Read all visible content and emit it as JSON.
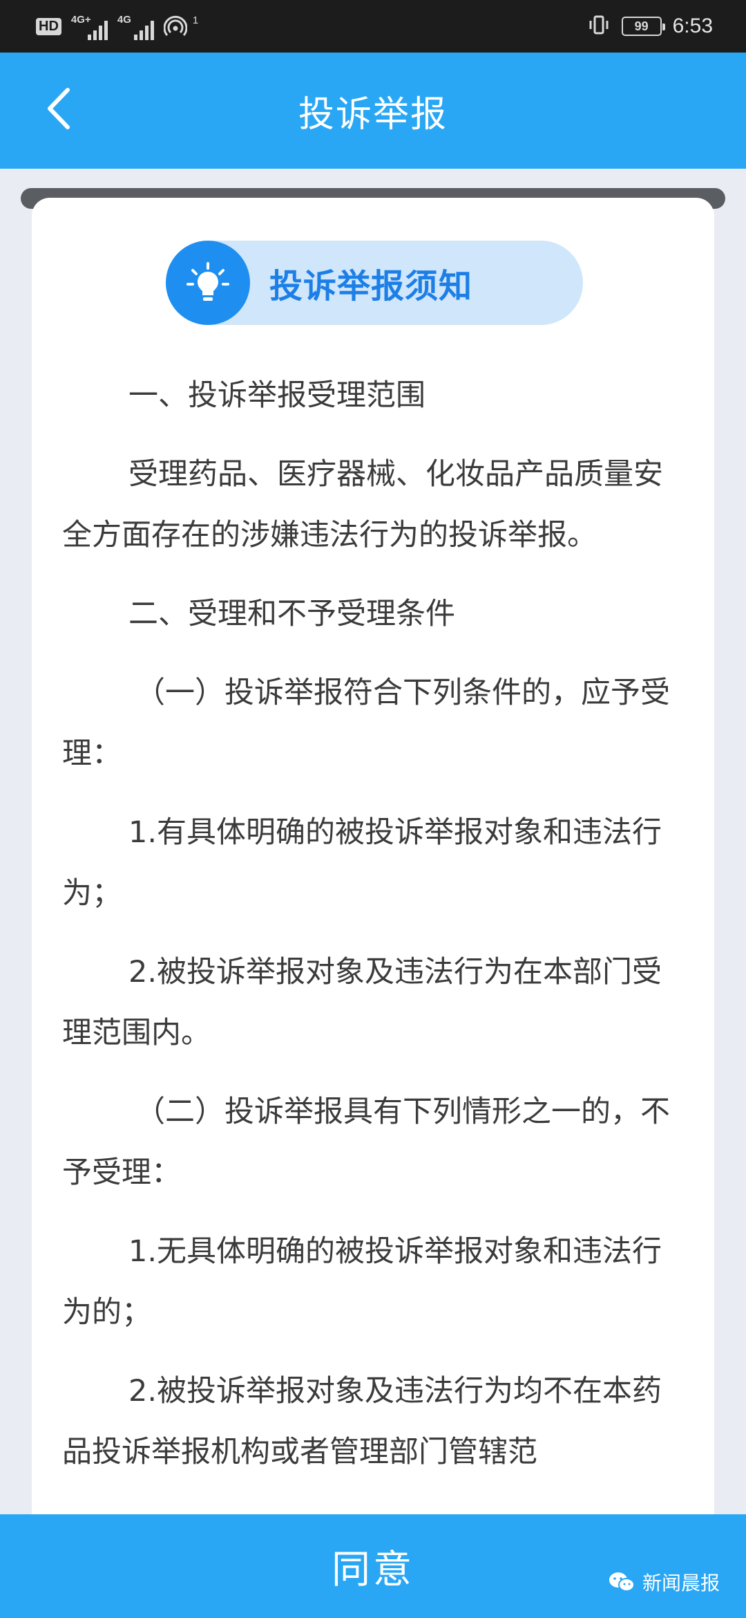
{
  "status_bar": {
    "hd": "HD",
    "network_1": "4G+",
    "network_2": "4G",
    "hotspot_count": "1",
    "battery": "99",
    "time": "6:53"
  },
  "header": {
    "title": "投诉举报",
    "back_icon": "chevron-left-icon"
  },
  "notice": {
    "title": "投诉举报须知",
    "icon": "lightbulb-icon"
  },
  "content": {
    "p1": "一、投诉举报受理范围",
    "p2": "受理药品、医疗器械、化妆品产品质量安全方面存在的涉嫌违法行为的投诉举报。",
    "p3": "二、受理和不予受理条件",
    "p4": "（一）投诉举报符合下列条件的，应予受理：",
    "p5": "1.有具体明确的被投诉举报对象和违法行为；",
    "p6": "2.被投诉举报对象及违法行为在本部门受理范围内。",
    "p7": "（二）投诉举报具有下列情形之一的，不予受理：",
    "p8": "1.无具体明确的被投诉举报对象和违法行为的；",
    "p9": "2.被投诉举报对象及违法行为均不在本药品投诉举报机构或者管理部门管辖范"
  },
  "footer": {
    "agree_label": "同意",
    "watermark": "新闻晨报"
  },
  "colors": {
    "header_blue": "#2aa7f4",
    "accent_blue": "#1e8ff0",
    "pill_bg": "#cfe6fb",
    "text": "#3b3b3b"
  }
}
